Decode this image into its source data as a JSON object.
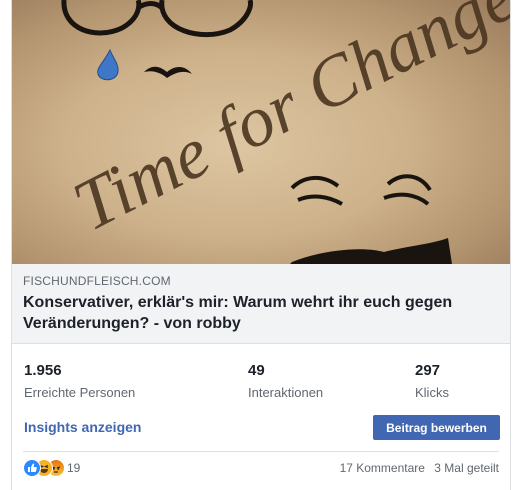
{
  "link": {
    "image_text": "Time for Change",
    "domain": "FISCHUNDFLEISCH.COM",
    "headline": "Konservativer, erklär's mir: Warum wehrt ihr euch gegen Veränderungen? - von robby"
  },
  "stats": [
    {
      "value": "1.956",
      "label": "Erreichte Personen"
    },
    {
      "value": "49",
      "label": "Interaktionen"
    },
    {
      "value": "297",
      "label": "Klicks"
    }
  ],
  "actions": {
    "insights_label": "Insights anzeigen",
    "boost_label": "Beitrag bewerben"
  },
  "footer": {
    "reactions": [
      "like-icon",
      "haha-icon",
      "angry-icon"
    ],
    "reaction_count": "19",
    "comments": "17 Kommentare",
    "shares": "3 Mal geteilt"
  },
  "colors": {
    "accent": "#4267b2",
    "meta_background": "#f2f3f5",
    "secondary_text": "#606770"
  }
}
